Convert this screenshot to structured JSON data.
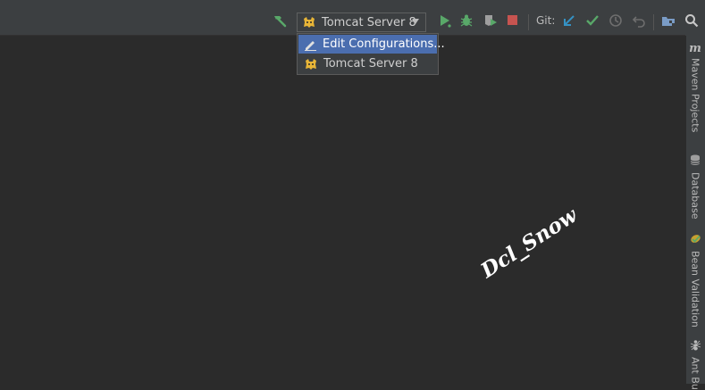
{
  "toolbar": {
    "run_config_label": "Tomcat Server 8",
    "git_label": "Git:"
  },
  "dropdown": {
    "items": [
      {
        "label": "Edit Configurations...",
        "selected": true
      },
      {
        "label": "Tomcat Server 8",
        "selected": false
      }
    ]
  },
  "right_sidebar": {
    "tabs": [
      {
        "label": "Maven Projects",
        "icon": "maven-icon"
      },
      {
        "label": "Database",
        "icon": "database-icon"
      },
      {
        "label": "Bean Validation",
        "icon": "bean-validation-icon"
      },
      {
        "label": "Ant Bu",
        "icon": "ant-icon"
      }
    ]
  },
  "watermark": "Dcl_Snow",
  "colors": {
    "toolbar_bg": "#3c3f41",
    "editor_bg": "#2b2b2b",
    "selection": "#4b6eaf",
    "run_green": "#59a869",
    "stop_red": "#c75450",
    "vcs_blue": "#3592c4"
  }
}
